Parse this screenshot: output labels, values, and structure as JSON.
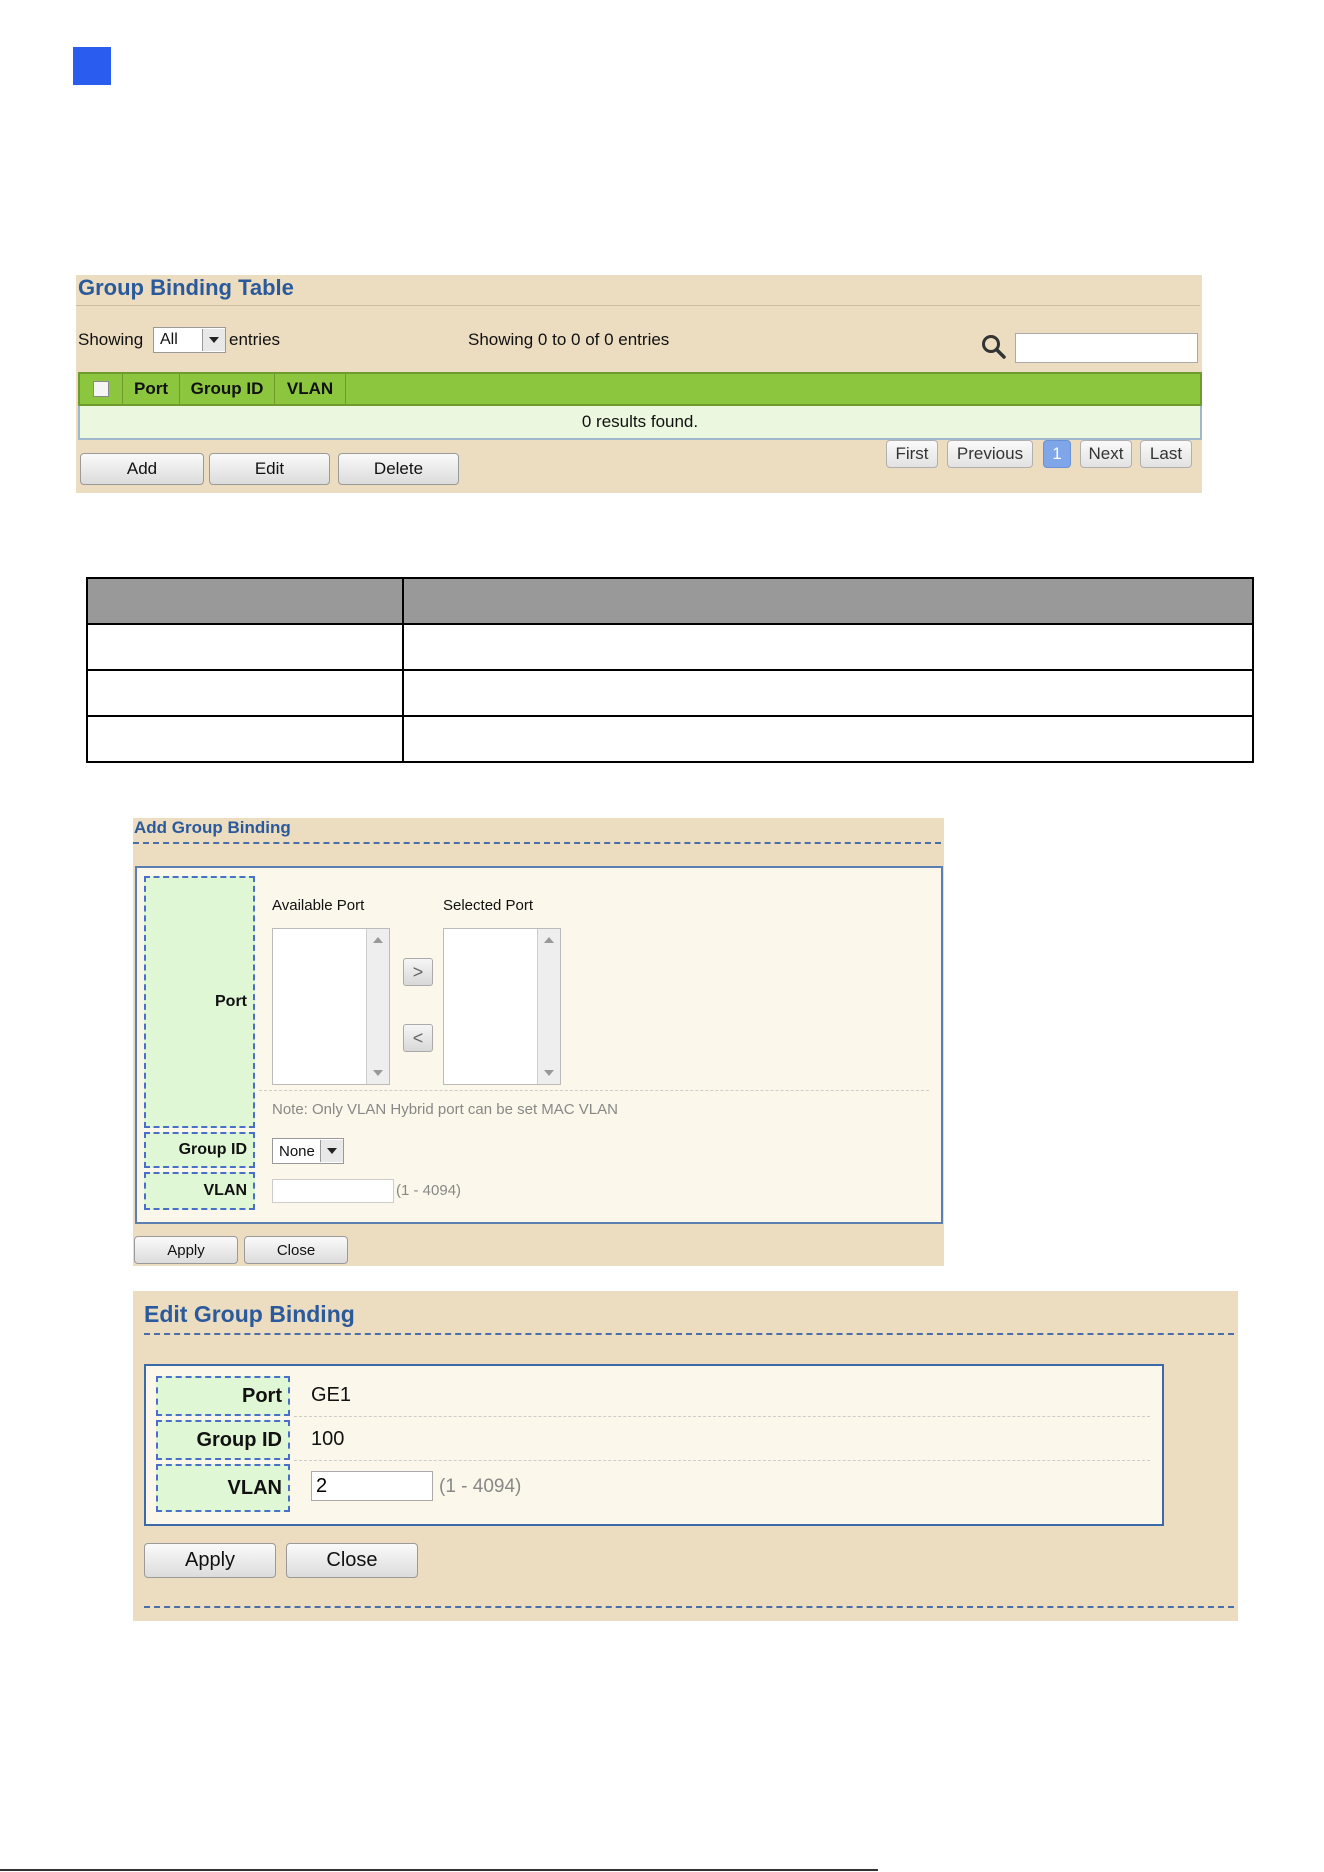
{
  "gbt": {
    "title": "Group Binding Table",
    "showing_label": "Showing",
    "entries_select": "All",
    "entries_label": "entries",
    "summary": "Showing 0 to 0 of 0 entries",
    "columns": [
      "Port",
      "Group ID",
      "VLAN"
    ],
    "empty_text": "0 results found.",
    "buttons": {
      "add": "Add",
      "edit": "Edit",
      "delete": "Delete"
    },
    "pagination": {
      "first": "First",
      "previous": "Previous",
      "page": "1",
      "next": "Next",
      "last": "Last"
    }
  },
  "add_panel": {
    "title": "Add Group Binding",
    "port_label": "Port",
    "available_port_label": "Available Port",
    "selected_port_label": "Selected Port",
    "move_right": ">",
    "move_left": "<",
    "note": "Note: Only VLAN Hybrid port can be set MAC VLAN",
    "group_id_label": "Group ID",
    "group_id_value": "None",
    "vlan_label": "VLAN",
    "vlan_value": "",
    "vlan_hint": "(1 - 4094)",
    "apply": "Apply",
    "close": "Close"
  },
  "edit_panel": {
    "title": "Edit Group Binding",
    "port_label": "Port",
    "port_value": "GE1",
    "group_id_label": "Group ID",
    "group_id_value": "100",
    "vlan_label": "VLAN",
    "vlan_value": "2",
    "vlan_hint": "(1 - 4094)",
    "apply": "Apply",
    "close": "Close"
  },
  "colors": {
    "header_green": "#8cc63f",
    "panel_tan": "#ecdcc0",
    "title_blue": "#2a5a9c",
    "accent_square": "#2b5cf0"
  }
}
